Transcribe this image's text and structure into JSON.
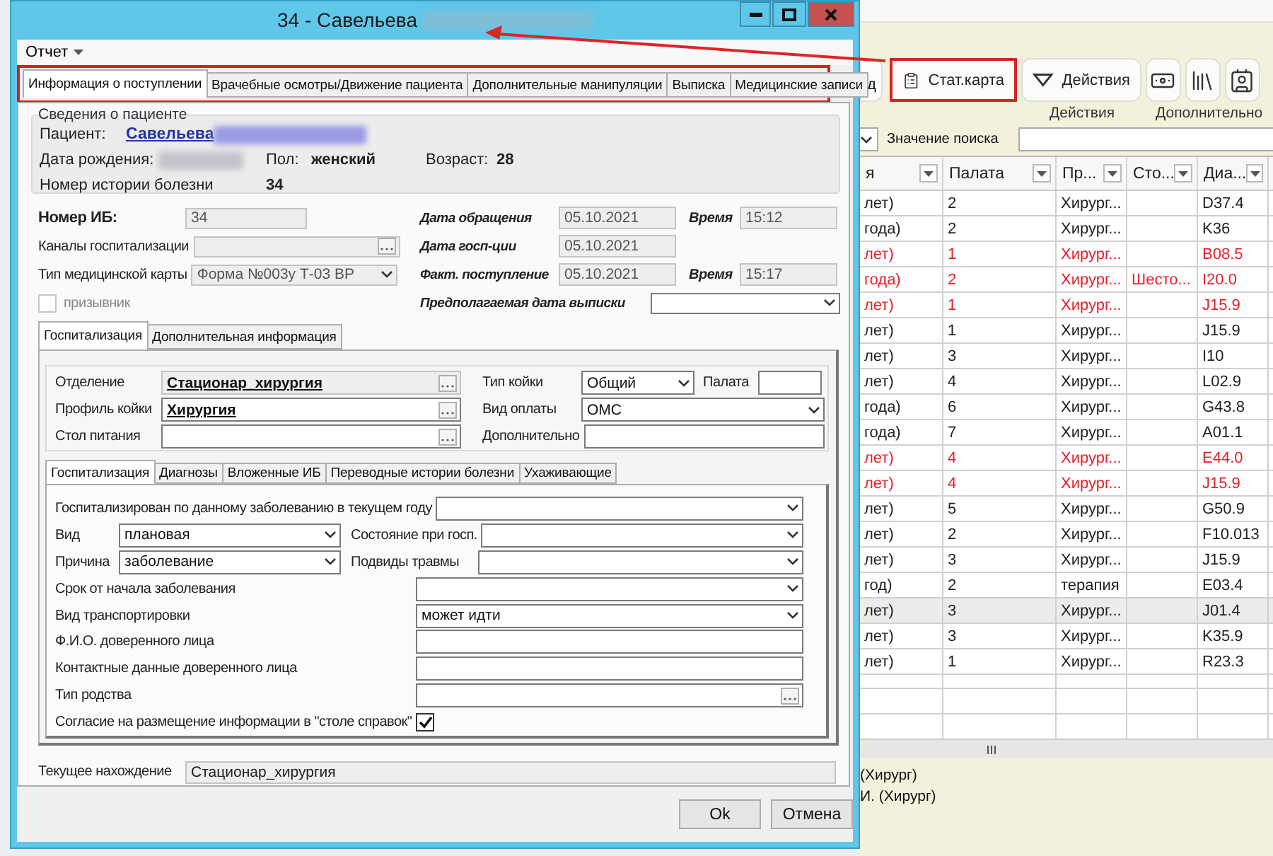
{
  "dialog": {
    "title": "34 - Савельева",
    "menu": "Отчет",
    "tabs": [
      {
        "label": "Информация о поступлении",
        "selected": true
      },
      {
        "label": "Врачебные осмотры/Движение пациента",
        "selected": false
      },
      {
        "label": "Дополнительные манипуляции",
        "selected": false
      },
      {
        "label": "Выписка",
        "selected": false
      },
      {
        "label": "Медицинские записи",
        "selected": false
      }
    ],
    "patient": {
      "title": "Сведения о пациенте",
      "name_label": "Пациент:",
      "name": "Савельева",
      "birth_label": "Дата рождения:",
      "sex_label": "Пол:",
      "sex": "женский",
      "age_label": "Возраст:",
      "age": "28",
      "history_label": "Номер истории болезни",
      "history": "34"
    },
    "record_fields": [
      {
        "label": "Номер ИБ:",
        "kind": "text",
        "value": "34",
        "disabled": true,
        "bold": true
      },
      {
        "label": "Каналы госпитализации",
        "kind": "picker",
        "disabled": true
      },
      {
        "label": "Тип медицинской карты",
        "kind": "select",
        "value": "Форма №003у Т-03 ВР",
        "disabled": true
      },
      {
        "label": "призывник",
        "kind": "checkbox",
        "checked": false,
        "disabled": true
      }
    ],
    "dates": [
      {
        "kind": "date",
        "label": "Дата обращения",
        "value": "05.10.2021",
        "time_label": "Время",
        "time": "15:12"
      },
      {
        "kind": "date",
        "label": "Дата госп-ции",
        "value": "05.10.2021"
      },
      {
        "kind": "date",
        "label": "Факт. поступление",
        "value": "05.10.2021",
        "time_label": "Время",
        "time": "15:17"
      },
      {
        "kind": "dropdown",
        "label": "Предполагаемая дата выписки"
      }
    ],
    "sections": [
      {
        "label": "Госпитализация",
        "selected": true
      },
      {
        "label": "Дополнительная информация",
        "selected": false
      }
    ],
    "ward_fields": {
      "left": [
        {
          "label": "Отделение",
          "kind": "picker",
          "value": "Стационар_хирургия",
          "disabled": true
        },
        {
          "label": "Профиль койки",
          "kind": "picker",
          "value": "Хирургия",
          "disabled": false
        },
        {
          "label": "Стол питания",
          "kind": "picker",
          "disabled": false
        }
      ],
      "right": [
        {
          "label": "Тип койки",
          "kind": "select",
          "value": "Общий"
        },
        {
          "label": "Палата",
          "kind": "text"
        },
        {
          "label": "Вид оплаты",
          "kind": "select",
          "value": "ОМС"
        },
        {
          "label": "Дополнительно",
          "kind": "text"
        }
      ]
    },
    "subtabs": [
      {
        "label": "Госпитализация",
        "selected": true
      },
      {
        "label": "Диагнозы",
        "selected": false
      },
      {
        "label": "Вложенные ИБ",
        "selected": false
      },
      {
        "label": "Переводные истории болезни",
        "selected": false
      },
      {
        "label": "Ухаживающие",
        "selected": false
      }
    ],
    "hospitalization": [
      {
        "kind": "select",
        "label": "Госпитализирован по данному заболеванию в текущем году"
      },
      {
        "kind": "pair",
        "fields": [
          {
            "label": "Вид",
            "value": "плановая"
          },
          {
            "label": "Состояние при госп."
          }
        ]
      },
      {
        "kind": "pair",
        "fields": [
          {
            "label": "Причина",
            "value": "заболевание"
          },
          {
            "label": "Подвиды травмы"
          }
        ]
      },
      {
        "kind": "select",
        "label": "Срок от начала заболевания"
      },
      {
        "kind": "select",
        "label": "Вид транспортировки",
        "value": "может идти"
      },
      {
        "kind": "text",
        "label": "Ф.И.О. доверенного лица"
      },
      {
        "kind": "text",
        "label": "Контактные данные доверенного лица"
      },
      {
        "kind": "picker",
        "label": "Тип родства"
      },
      {
        "kind": "checkbox",
        "label": "Согласие на размещение информации в \"столе справок\"",
        "checked": true
      }
    ],
    "current_location": {
      "label": "Текущее нахождение",
      "value": "Стационар_хирургия"
    },
    "buttons": [
      "Ok",
      "Отмена"
    ]
  },
  "app": {
    "toolbar": [
      {
        "kind": "partial",
        "label": "д",
        "highlighted": false
      },
      {
        "kind": "labeled",
        "label": "Стат.карта",
        "highlighted": true
      },
      {
        "kind": "labeled",
        "label": "Действия",
        "highlighted": false
      },
      {
        "kind": "icon",
        "highlighted": false
      },
      {
        "kind": "icon",
        "highlighted": false
      },
      {
        "kind": "icon",
        "highlighted": false
      }
    ],
    "groups": [
      "Действия",
      "Дополнительно"
    ],
    "search_label": "Значение поиска",
    "columns": [
      "я",
      "Палата",
      "Пр...",
      "Сто...",
      "Диа..."
    ],
    "rows": [
      {
        "cells": [
          "лет)",
          "2",
          "Хирург...",
          "",
          "D37.4"
        ],
        "alert": false,
        "selected": false
      },
      {
        "cells": [
          "года)",
          "2",
          "Хирург...",
          "",
          "K36"
        ],
        "alert": false,
        "selected": false
      },
      {
        "cells": [
          "лет)",
          "1",
          "Хирург...",
          "",
          "B08.5"
        ],
        "alert": true,
        "selected": false
      },
      {
        "cells": [
          "года)",
          "2",
          "Хирург...",
          "Шесто...",
          "I20.0"
        ],
        "alert": true,
        "selected": false
      },
      {
        "cells": [
          "лет)",
          "1",
          "Хирург...",
          "",
          "J15.9"
        ],
        "alert": true,
        "selected": false
      },
      {
        "cells": [
          "лет)",
          "1",
          "Хирург...",
          "",
          "J15.9"
        ],
        "alert": false,
        "selected": false
      },
      {
        "cells": [
          "лет)",
          "3",
          "Хирург...",
          "",
          "I10"
        ],
        "alert": false,
        "selected": false
      },
      {
        "cells": [
          "лет)",
          "4",
          "Хирург...",
          "",
          "L02.9"
        ],
        "alert": false,
        "selected": false
      },
      {
        "cells": [
          "года)",
          "6",
          "Хирург...",
          "",
          "G43.8"
        ],
        "alert": false,
        "selected": false
      },
      {
        "cells": [
          "года)",
          "7",
          "Хирург...",
          "",
          "A01.1"
        ],
        "alert": false,
        "selected": false
      },
      {
        "cells": [
          "лет)",
          "4",
          "Хирург...",
          "",
          "E44.0"
        ],
        "alert": true,
        "selected": false
      },
      {
        "cells": [
          "лет)",
          "4",
          "Хирург...",
          "",
          "J15.9"
        ],
        "alert": true,
        "selected": false
      },
      {
        "cells": [
          "лет)",
          "5",
          "Хирург...",
          "",
          "G50.9"
        ],
        "alert": false,
        "selected": false
      },
      {
        "cells": [
          "лет)",
          "2",
          "Хирург...",
          "",
          "F10.013"
        ],
        "alert": false,
        "selected": false
      },
      {
        "cells": [
          "лет)",
          "3",
          "Хирург...",
          "",
          "J15.9"
        ],
        "alert": false,
        "selected": false
      },
      {
        "cells": [
          "год)",
          "2",
          "терапия",
          "",
          "E03.4"
        ],
        "alert": false,
        "selected": false
      },
      {
        "cells": [
          "лет)",
          "3",
          "Хирург...",
          "",
          "J01.4"
        ],
        "alert": false,
        "selected": true
      },
      {
        "cells": [
          "лет)",
          "3",
          "Хирург...",
          "",
          "K35.9"
        ],
        "alert": false,
        "selected": false
      },
      {
        "cells": [
          "лет)",
          "1",
          "Хирург...",
          "",
          "R23.3"
        ],
        "alert": false,
        "selected": false
      }
    ],
    "notes": [
      "(Хирург)",
      "И. (Хирург)"
    ]
  }
}
